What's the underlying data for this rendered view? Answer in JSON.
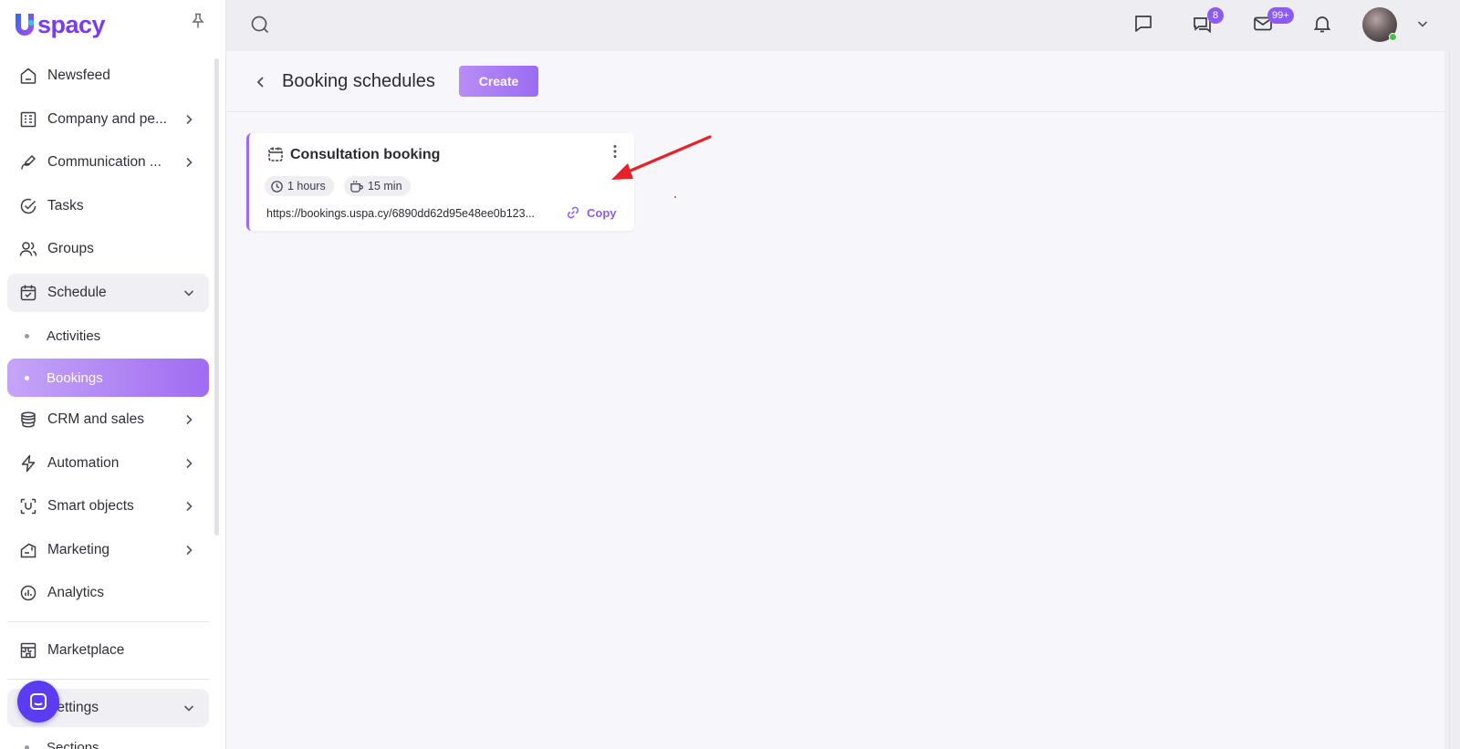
{
  "brand": {
    "logo_letter": "U",
    "logo_text": "spacy",
    "accent": "#8c5cf2"
  },
  "sidebar": {
    "items": [
      {
        "label": "Newsfeed",
        "icon": "home-icon"
      },
      {
        "label": "Company and pe...",
        "icon": "building-icon"
      },
      {
        "label": "Communication ...",
        "icon": "chat-pen-icon"
      },
      {
        "label": "Tasks",
        "icon": "check-circle-icon"
      },
      {
        "label": "Groups",
        "icon": "users-icon"
      },
      {
        "label": "Schedule",
        "icon": "calendar-check-icon",
        "expanded": true
      },
      {
        "label": "CRM and sales",
        "icon": "coins-icon"
      },
      {
        "label": "Automation",
        "icon": "lightning-icon"
      },
      {
        "label": "Smart objects",
        "icon": "smart-object-icon"
      },
      {
        "label": "Marketing",
        "icon": "megaphone-icon"
      },
      {
        "label": "Analytics",
        "icon": "chart-pie-icon"
      },
      {
        "label": "Marketplace",
        "icon": "store-icon"
      },
      {
        "label": "Settings",
        "icon": "gear-icon",
        "expanded": true
      }
    ],
    "schedule_sub": [
      {
        "label": "Activities"
      },
      {
        "label": "Bookings",
        "active": true
      }
    ],
    "settings_sub": [
      {
        "label": "Sections"
      }
    ]
  },
  "topbar": {
    "messenger_badge": "8",
    "mail_badge": "99+"
  },
  "page": {
    "title": "Booking schedules",
    "create_label": "Create"
  },
  "booking_card": {
    "title": "Consultation booking",
    "duration": "1 hours",
    "break": "15 min",
    "url": "https://bookings.uspa.cy/6890dd62d95e48ee0b123...",
    "copy_label": "Copy"
  }
}
